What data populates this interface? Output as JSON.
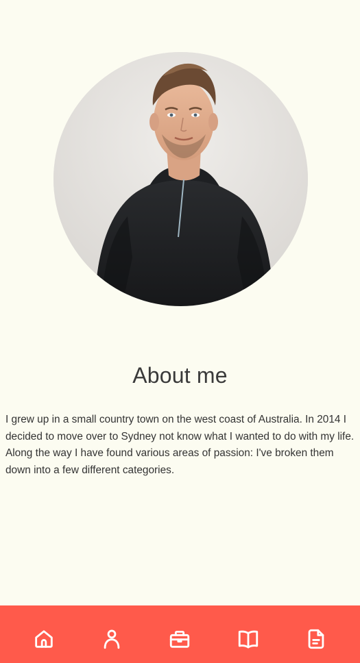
{
  "profile": {
    "photo_alt": "Profile photo",
    "heading": "About me",
    "bio": "I grew up in a small country town on the west coast of Australia. In 2014 I decided to move over to Sydney not know what I wanted to do with my life. Along the way I have found various areas of passion: I've broken them down into a few different categories."
  },
  "nav": {
    "items": [
      {
        "icon": "home-icon"
      },
      {
        "icon": "user-icon"
      },
      {
        "icon": "briefcase-icon"
      },
      {
        "icon": "book-icon"
      },
      {
        "icon": "document-icon"
      }
    ]
  },
  "colors": {
    "background": "#fcfcf1",
    "nav_background": "#ff5a4b",
    "nav_icon": "#ffffff",
    "text": "#333333"
  }
}
